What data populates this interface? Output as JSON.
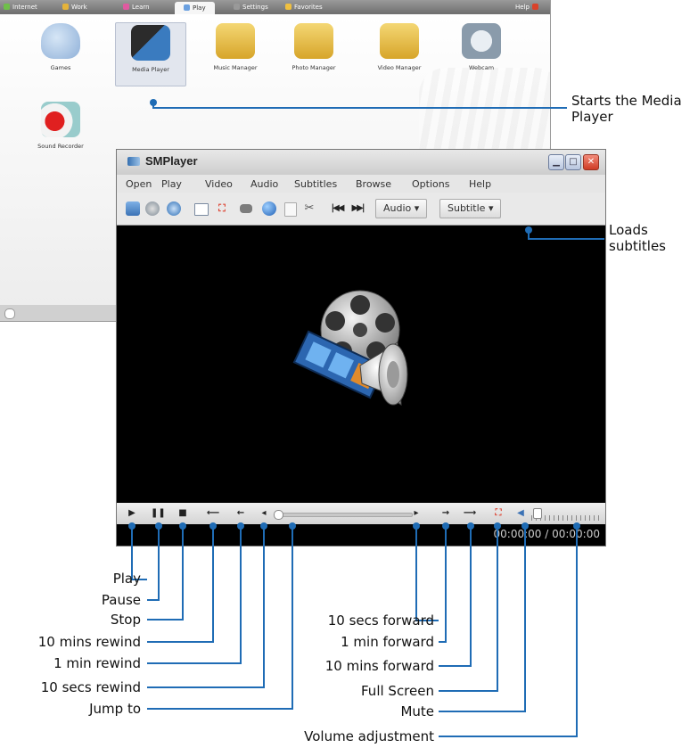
{
  "launcher": {
    "tabs": [
      {
        "label": "Internet",
        "color": "#6fbf4a"
      },
      {
        "label": "Work",
        "color": "#e5b33a"
      },
      {
        "label": "Learn",
        "color": "#e05aa0"
      },
      {
        "label": "Play",
        "color": "#6aa0e0",
        "active": true
      },
      {
        "label": "Settings",
        "color": "#999999"
      },
      {
        "label": "Favorites",
        "color": "#f0c040"
      },
      {
        "label": "Help",
        "color": "#d9422a"
      }
    ],
    "apps": [
      {
        "label": "Games",
        "icon": "gamepad-icon"
      },
      {
        "label": "Media Player",
        "icon": "media-player-icon",
        "selected": true
      },
      {
        "label": "Music Manager",
        "icon": "music-folder-icon"
      },
      {
        "label": "Photo Manager",
        "icon": "photo-folder-icon"
      },
      {
        "label": "Video Manager",
        "icon": "video-folder-icon"
      },
      {
        "label": "Webcam",
        "icon": "webcam-icon"
      },
      {
        "label": "Sound Recorder",
        "icon": "microphone-icon"
      }
    ]
  },
  "player": {
    "title": "SMPlayer",
    "menu": [
      "Open",
      "Play",
      "Video",
      "Audio",
      "Subtitles",
      "Browse",
      "Options",
      "Help"
    ],
    "menu_accel": [
      "O",
      "P",
      "V",
      "A",
      "S",
      "B",
      "O",
      "H"
    ],
    "toolbar": {
      "audio_label": "Audio",
      "subtitle_label": "Subtitle",
      "icons": [
        "open-folder-icon",
        "dvd-globe-icon",
        "web-globe-icon",
        "compact-view-icon",
        "fullscreen-icon",
        "dvd-icon",
        "playlist-icon",
        "info-icon",
        "preferences-icon",
        "previous-track-icon",
        "next-track-icon"
      ]
    },
    "time": "00:00:00 / 00:00:00",
    "seek_position": 0,
    "volume_level": 0
  },
  "callouts": {
    "media_player": "Starts the Media Player",
    "subtitles": "Loads subtitles",
    "play": "Play",
    "pause": "Pause",
    "stop": "Stop",
    "rew10m": "10 mins rewind",
    "rew1m": "1 min rewind",
    "rew10s": "10 secs rewind",
    "jump": "Jump to",
    "fwd10s": "10 secs forward",
    "fwd1m": "1 min forward",
    "fwd10m": "10 mins forward",
    "fullscreen": "Full Screen",
    "mute": "Mute",
    "volume": "Volume adjustment"
  }
}
